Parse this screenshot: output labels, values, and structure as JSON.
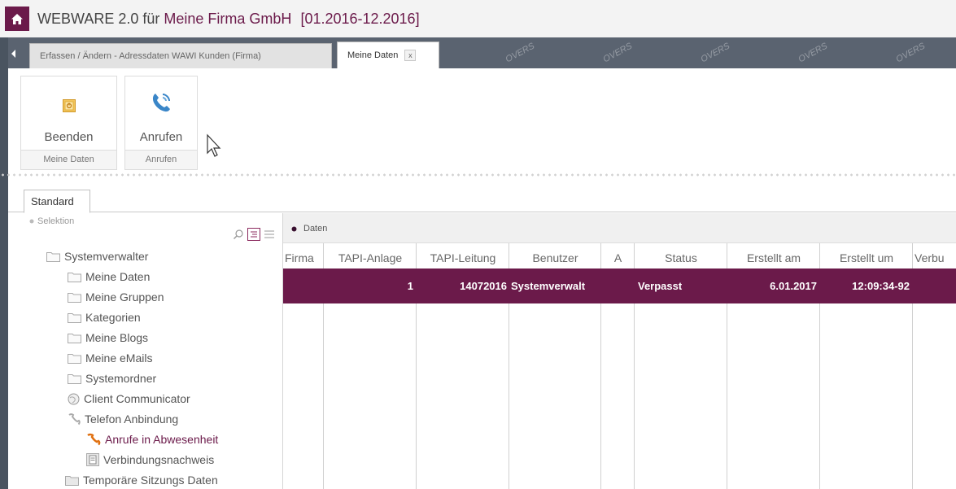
{
  "window": {
    "title_prefix": "WEBWARE 2.0 für",
    "title_firm": "Meine Firma GmbH",
    "title_period": "[01.2016-12.2016]"
  },
  "tabs": [
    {
      "label": "Erfassen / Ändern - Adressdaten WAWI Kunden (Firma)"
    },
    {
      "label": "Meine Daten",
      "close": "x"
    }
  ],
  "watermark": "OVERS",
  "toolbar": {
    "buttons": [
      {
        "label": "Beenden",
        "group": "Meine Daten",
        "icon": "power-icon"
      },
      {
        "label": "Anrufen",
        "group": "Anrufen",
        "icon": "phone-icon"
      }
    ]
  },
  "panel_tab": "Standard",
  "selection_label": "Selektion",
  "tree": [
    {
      "label": "Systemverwalter",
      "icon": "folder-icon"
    },
    {
      "label": "Meine Daten",
      "icon": "folder-icon"
    },
    {
      "label": "Meine Gruppen",
      "icon": "folder-icon"
    },
    {
      "label": "Kategorien",
      "icon": "folder-icon"
    },
    {
      "label": "Meine Blogs",
      "icon": "folder-icon"
    },
    {
      "label": "Meine eMails",
      "icon": "folder-icon"
    },
    {
      "label": "Systemordner",
      "icon": "folder-icon"
    },
    {
      "label": "Client Communicator",
      "icon": "globe-icon"
    },
    {
      "label": "Telefon Anbindung",
      "icon": "handset-icon"
    },
    {
      "label": "Anrufe in Abwesenheit",
      "icon": "handset-icon"
    },
    {
      "label": "Verbindungsnachweis",
      "icon": "document-icon"
    },
    {
      "label": "Temporäre Sitzungs Daten",
      "icon": "folder-icon"
    }
  ],
  "grid": {
    "title": "Daten",
    "columns": [
      "Firma",
      "TAPI-Anlage",
      "TAPI-Leitung",
      "Benutzer",
      "A",
      "Status",
      "Erstellt am",
      "Erstellt um",
      "Verbu"
    ],
    "rows": [
      [
        "",
        "1",
        "14072016",
        "Systemverwalt",
        "",
        "Verpasst",
        "6.01.2017",
        "12:09:34-92",
        ""
      ]
    ]
  },
  "colors": {
    "accent": "#6b1a4a",
    "tabbar": "#5a6370"
  }
}
